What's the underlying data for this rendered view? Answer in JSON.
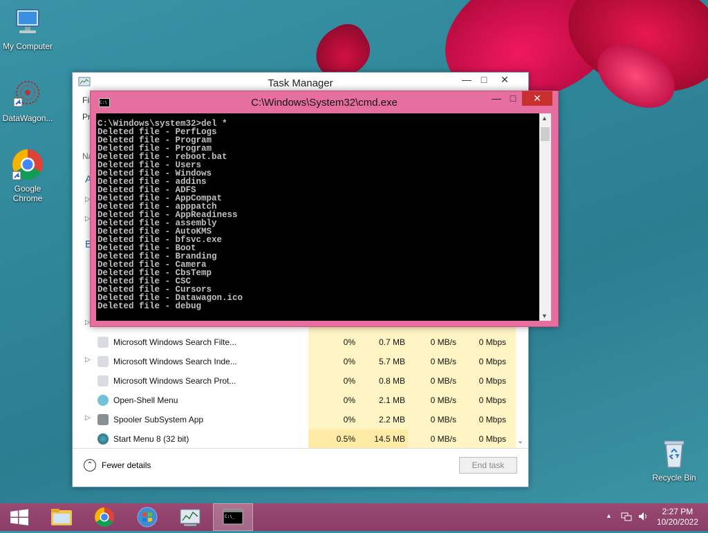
{
  "desktop": {
    "icons": [
      {
        "label": "My Computer"
      },
      {
        "label": "DataWagon..."
      },
      {
        "label": "Google Chrome"
      },
      {
        "label": "Recycle Bin"
      }
    ]
  },
  "task_manager": {
    "title": "Task Manager",
    "processes": [
      {
        "name": "Microsoft Windows Search Filte...",
        "expandable": false,
        "cpu": "0%",
        "memory": "0.7 MB",
        "disk": "0 MB/s",
        "network": "0 Mbps"
      },
      {
        "name": "Microsoft Windows Search Inde...",
        "expandable": true,
        "cpu": "0%",
        "memory": "5.7 MB",
        "disk": "0 MB/s",
        "network": "0 Mbps"
      },
      {
        "name": "Microsoft Windows Search Prot...",
        "expandable": false,
        "cpu": "0%",
        "memory": "0.8 MB",
        "disk": "0 MB/s",
        "network": "0 Mbps"
      },
      {
        "name": "Open-Shell Menu",
        "expandable": false,
        "cpu": "0%",
        "memory": "2.1 MB",
        "disk": "0 MB/s",
        "network": "0 Mbps"
      },
      {
        "name": "Spooler SubSystem App",
        "expandable": true,
        "cpu": "0%",
        "memory": "2.2 MB",
        "disk": "0 MB/s",
        "network": "0 Mbps"
      },
      {
        "name": "Start Menu 8 (32 bit)",
        "expandable": false,
        "cpu": "0.5%",
        "memory": "14.5 MB",
        "disk": "0 MB/s",
        "network": "0 Mbps"
      }
    ],
    "fewer_details": "Fewer details",
    "end_task": "End task",
    "partial_left_text": [
      "Fil",
      "Pr",
      "Na",
      "A",
      "B"
    ]
  },
  "cmd": {
    "title": "C:\\Windows\\System32\\cmd.exe",
    "lines": [
      "C:\\Windows\\system32>del *",
      "Deleted file - PerfLogs",
      "Deleted file - Program",
      "Deleted file - Program",
      "Deleted file - reboot.bat",
      "Deleted file - Users",
      "Deleted file - Windows",
      "Deleted file - addins",
      "Deleted file - ADFS",
      "Deleted file - AppCompat",
      "Deleted file - apppatch",
      "Deleted file - AppReadiness",
      "Deleted file - assembly",
      "Deleted file - AutoKMS",
      "Deleted file - bfsvc.exe",
      "Deleted file - Boot",
      "Deleted file - Branding",
      "Deleted file - Camera",
      "Deleted file - CbsTemp",
      "Deleted file - CSC",
      "Deleted file - Cursors",
      "Deleted file - Datawagon.ico",
      "Deleted file - debug"
    ]
  },
  "taskbar": {
    "time": "2:27 PM",
    "date": "10/20/2022"
  }
}
